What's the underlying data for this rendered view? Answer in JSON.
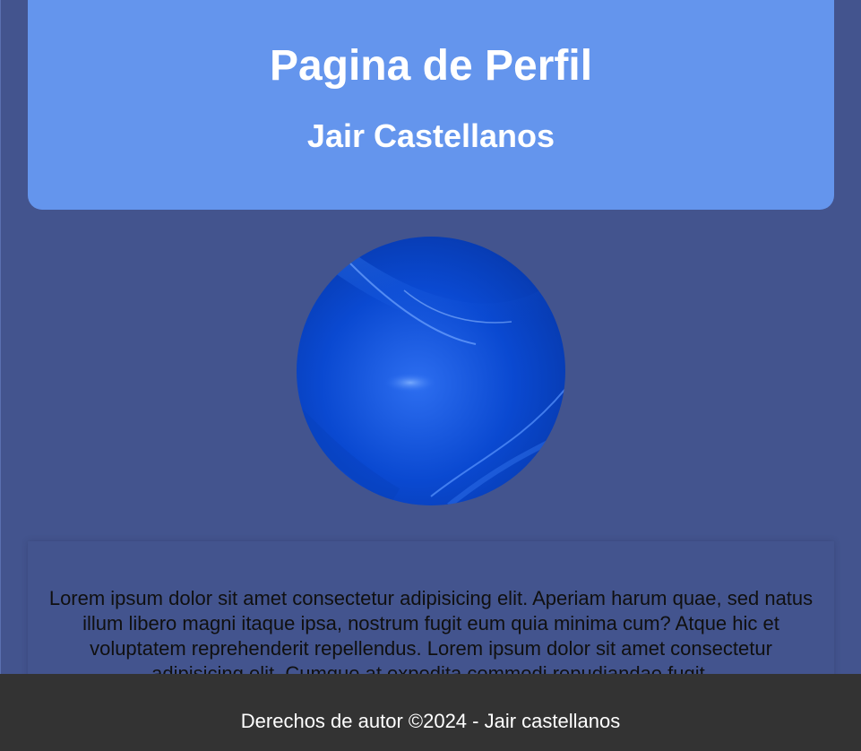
{
  "header": {
    "title": "Pagina de Perfil",
    "subtitle": "Jair Castellanos"
  },
  "profile": {
    "avatar_icon": "blue-sphere-avatar-icon"
  },
  "about": {
    "text": "Lorem ipsum dolor sit amet consectetur adipisicing elit. Aperiam harum quae, sed natus illum libero magni itaque ipsa, nostrum fugit eum quia minima cum? Atque hic et voluptatem reprehenderit repellendus. Lorem ipsum dolor sit amet consectetur adipisicing elit. Cumque at expedita commodi repudiandae fugit."
  },
  "footer": {
    "copyright": "Derechos de autor ©2024 - Jair castellanos"
  },
  "colors": {
    "background": "#43548e",
    "header": "#6495ed",
    "footer": "#333333",
    "avatar_primary": "#0a49d1"
  }
}
